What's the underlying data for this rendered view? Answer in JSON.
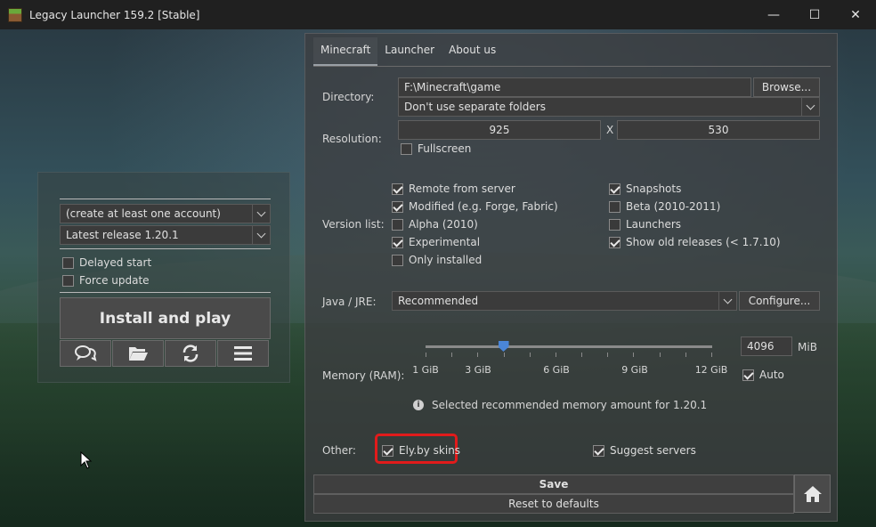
{
  "window": {
    "title": "Legacy Launcher 159.2 [Stable]",
    "controls": {
      "minimize": "—",
      "maximize": "☐",
      "close": "✕"
    }
  },
  "left_panel": {
    "account_select": "(create at least one account)",
    "version_select": "Latest release 1.20.1",
    "delayed_start": {
      "label": "Delayed start",
      "checked": false
    },
    "force_update": {
      "label": "Force update",
      "checked": false
    },
    "play_button": "Install and play",
    "icon_buttons": [
      "chat-icon",
      "folder-icon",
      "refresh-icon",
      "menu-icon"
    ]
  },
  "settings": {
    "tabs": [
      {
        "label": "Minecraft",
        "active": true
      },
      {
        "label": "Launcher",
        "active": false
      },
      {
        "label": "About us",
        "active": false
      }
    ],
    "directory": {
      "label": "Directory:",
      "path": "F:\\Minecraft\\game",
      "browse": "Browse...",
      "folders_option": "Don't use separate folders"
    },
    "resolution": {
      "label": "Resolution:",
      "width": "925",
      "separator": "X",
      "height": "530",
      "fullscreen": {
        "label": "Fullscreen",
        "checked": false
      }
    },
    "version_list": {
      "label": "Version list:",
      "left": [
        {
          "label": "Remote from server",
          "checked": true
        },
        {
          "label": "Modified (e.g. Forge, Fabric)",
          "checked": true
        },
        {
          "label": "Alpha (2010)",
          "checked": false
        },
        {
          "label": "Experimental",
          "checked": true
        },
        {
          "label": "Only installed",
          "checked": false
        }
      ],
      "right": [
        {
          "label": "Snapshots",
          "checked": true
        },
        {
          "label": "Beta (2010-2011)",
          "checked": false
        },
        {
          "label": "Launchers",
          "checked": false
        },
        {
          "label": "Show old releases (< 1.7.10)",
          "checked": true
        }
      ]
    },
    "java": {
      "label": "Java / JRE:",
      "selected": "Recommended",
      "configure": "Configure..."
    },
    "memory": {
      "label": "Memory (RAM):",
      "value": "4096",
      "unit": "MiB",
      "auto": {
        "label": "Auto",
        "checked": true
      },
      "ticks": [
        "1 GiB",
        "3 GiB",
        "6 GiB",
        "9 GiB",
        "12 GiB"
      ],
      "slider_value_gib": 4,
      "info": "Selected recommended memory amount for 1.20.1"
    },
    "other": {
      "label": "Other:",
      "elyby": {
        "label": "Ely.by skins",
        "checked": true
      },
      "suggest": {
        "label": "Suggest servers",
        "checked": true
      }
    },
    "save": "Save",
    "reset": "Reset to defaults"
  },
  "colors": {
    "highlight": "#e11b1b",
    "slider_thumb": "#4a86d8"
  }
}
